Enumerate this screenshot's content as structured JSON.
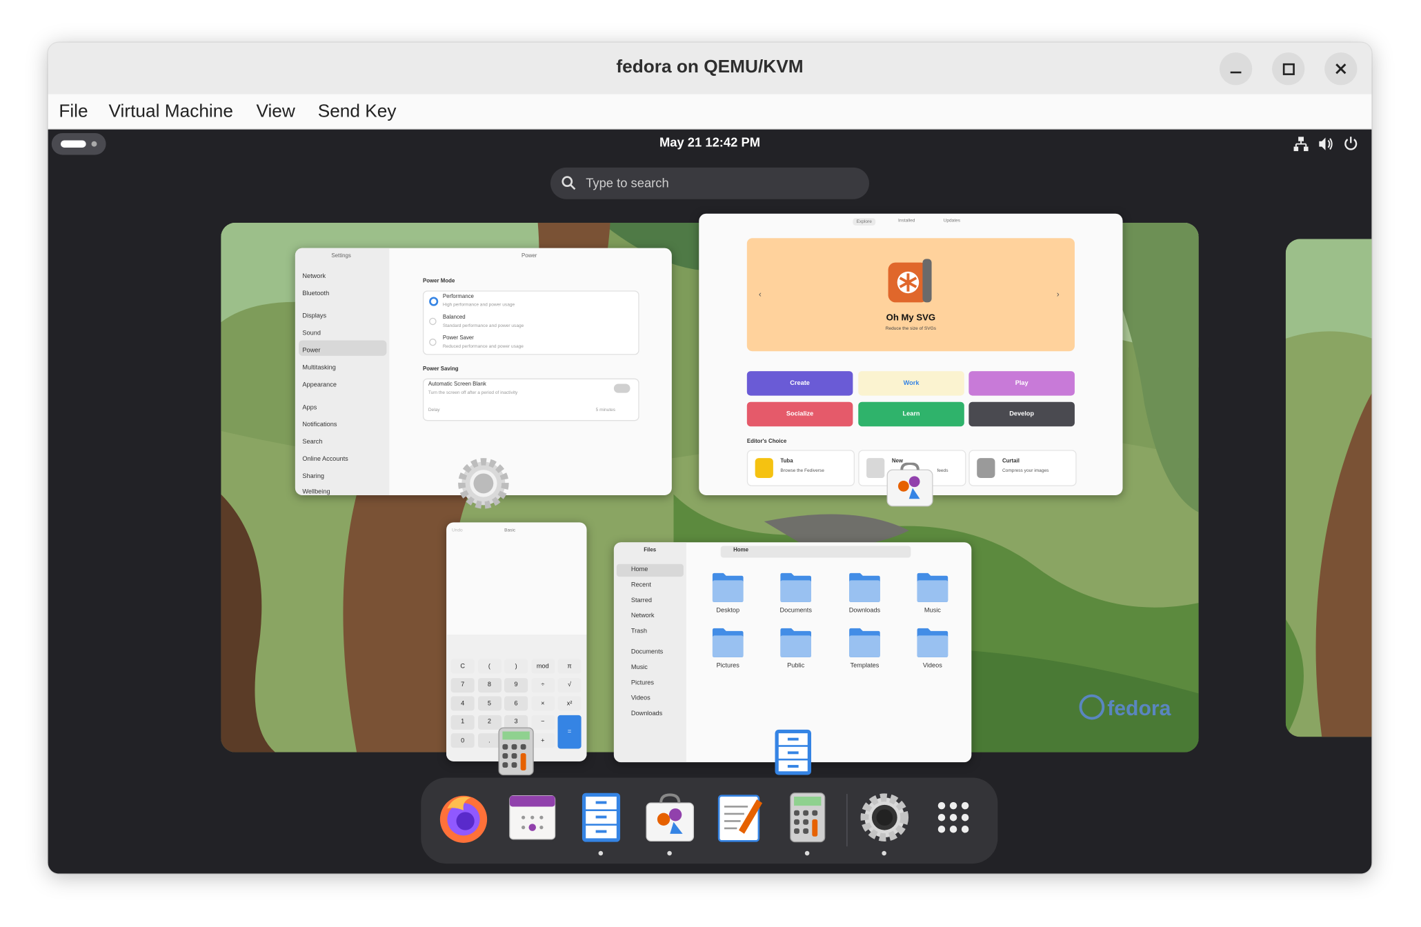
{
  "window": {
    "title": "fedora on QEMU/KVM",
    "controls": [
      "minimize",
      "maximize",
      "close"
    ]
  },
  "menubar": [
    "File",
    "Virtual Machine",
    "View",
    "Send Key"
  ],
  "gnome": {
    "clock": "May 21  12:42 PM",
    "search_placeholder": "Type to search",
    "status_icons": [
      "network-icon",
      "volume-icon",
      "power-icon"
    ]
  },
  "settings_window": {
    "sidebar_title": "Settings",
    "page_title": "Power",
    "sidebar_items": [
      "Network",
      "Bluetooth",
      "Displays",
      "Sound",
      "Power",
      "Multitasking",
      "Appearance",
      "Apps",
      "Notifications",
      "Search",
      "Online Accounts",
      "Sharing",
      "Wellbeing"
    ],
    "power_mode_heading": "Power Mode",
    "modes": [
      {
        "name": "Performance",
        "desc": "High performance and power usage"
      },
      {
        "name": "Balanced",
        "desc": "Standard performance and power usage"
      },
      {
        "name": "Power Saver",
        "desc": "Reduced performance and power usage"
      }
    ],
    "power_saving_heading": "Power Saving",
    "screen_blank": "Automatic Screen Blank",
    "screen_blank_desc": "Turn the screen off after a period of inactivity",
    "delay_label": "Delay",
    "delay_value": "5 minutes"
  },
  "software_window": {
    "tabs": [
      "Explore",
      "Installed",
      "Updates"
    ],
    "banner_title": "Oh My SVG",
    "banner_sub": "Reduce the size of SVGs",
    "categories": [
      {
        "label": "Create",
        "color": "#6a5bd6"
      },
      {
        "label": "Work",
        "color": "#fbf3d0"
      },
      {
        "label": "Play",
        "color": "#c87ad8"
      },
      {
        "label": "Socialize",
        "color": "#e55a6a"
      },
      {
        "label": "Learn",
        "color": "#2fb36b"
      },
      {
        "label": "Develop",
        "color": "#4a4a50"
      }
    ],
    "editors_choice": "Editor's Choice",
    "apps": [
      {
        "name": "Tuba",
        "desc": "Browse the Fediverse"
      },
      {
        "name": "New",
        "desc": "feeds"
      },
      {
        "name": "Curtail",
        "desc": "Compress your images"
      }
    ]
  },
  "calculator_window": {
    "undo": "Undo",
    "mode": "Basic",
    "keys": [
      [
        "C",
        "(",
        ")",
        "mod",
        "π"
      ],
      [
        "7",
        "8",
        "9",
        "÷",
        "√"
      ],
      [
        "4",
        "5",
        "6",
        "×",
        "x²"
      ],
      [
        "1",
        "2",
        "3",
        "−",
        "="
      ],
      [
        "0",
        ".",
        "%",
        "+",
        ""
      ]
    ]
  },
  "files_window": {
    "title": "Files",
    "path": "Home",
    "sidebar": [
      "Home",
      "Recent",
      "Starred",
      "Network",
      "Trash",
      "Documents",
      "Music",
      "Pictures",
      "Videos",
      "Downloads"
    ],
    "folders": [
      "Desktop",
      "Documents",
      "Downloads",
      "Music",
      "Pictures",
      "Public",
      "Templates",
      "Videos"
    ]
  },
  "wallpaper_logo": "fedora",
  "dash": {
    "apps": [
      {
        "name": "Firefox",
        "running": false
      },
      {
        "name": "Calendar",
        "running": false
      },
      {
        "name": "Files",
        "running": true
      },
      {
        "name": "Software",
        "running": true
      },
      {
        "name": "Text Editor",
        "running": false
      },
      {
        "name": "Calculator",
        "running": true
      },
      {
        "name": "Settings",
        "running": true
      },
      {
        "name": "Show Apps",
        "running": false
      }
    ]
  }
}
